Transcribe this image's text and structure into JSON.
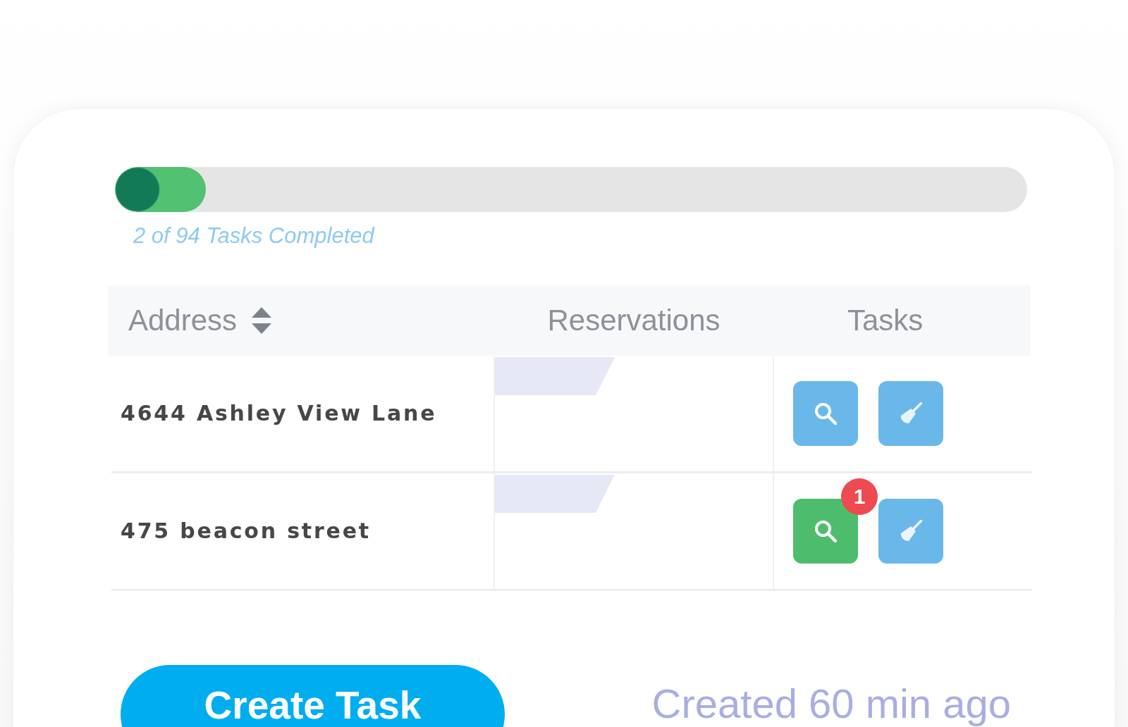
{
  "progress": {
    "level": 0.1,
    "label": "2 of 94 Tasks Completed"
  },
  "table": {
    "columns": [
      {
        "label": "Address",
        "sortable": true
      },
      {
        "label": "Reservations"
      },
      {
        "label": "Tasks"
      }
    ],
    "rows": [
      {
        "address": "4644 Ashley View Lane",
        "tasks": [
          {
            "kind": "search",
            "highlighted": false
          },
          {
            "kind": "clean",
            "highlighted": false
          }
        ]
      },
      {
        "address": "475 beacon street",
        "tasks": [
          {
            "kind": "search",
            "highlighted": true,
            "badge": "1"
          },
          {
            "kind": "clean",
            "highlighted": false
          }
        ]
      }
    ]
  },
  "create_button": {
    "label": "Create Task"
  },
  "created_label": "Created 60 min ago"
}
